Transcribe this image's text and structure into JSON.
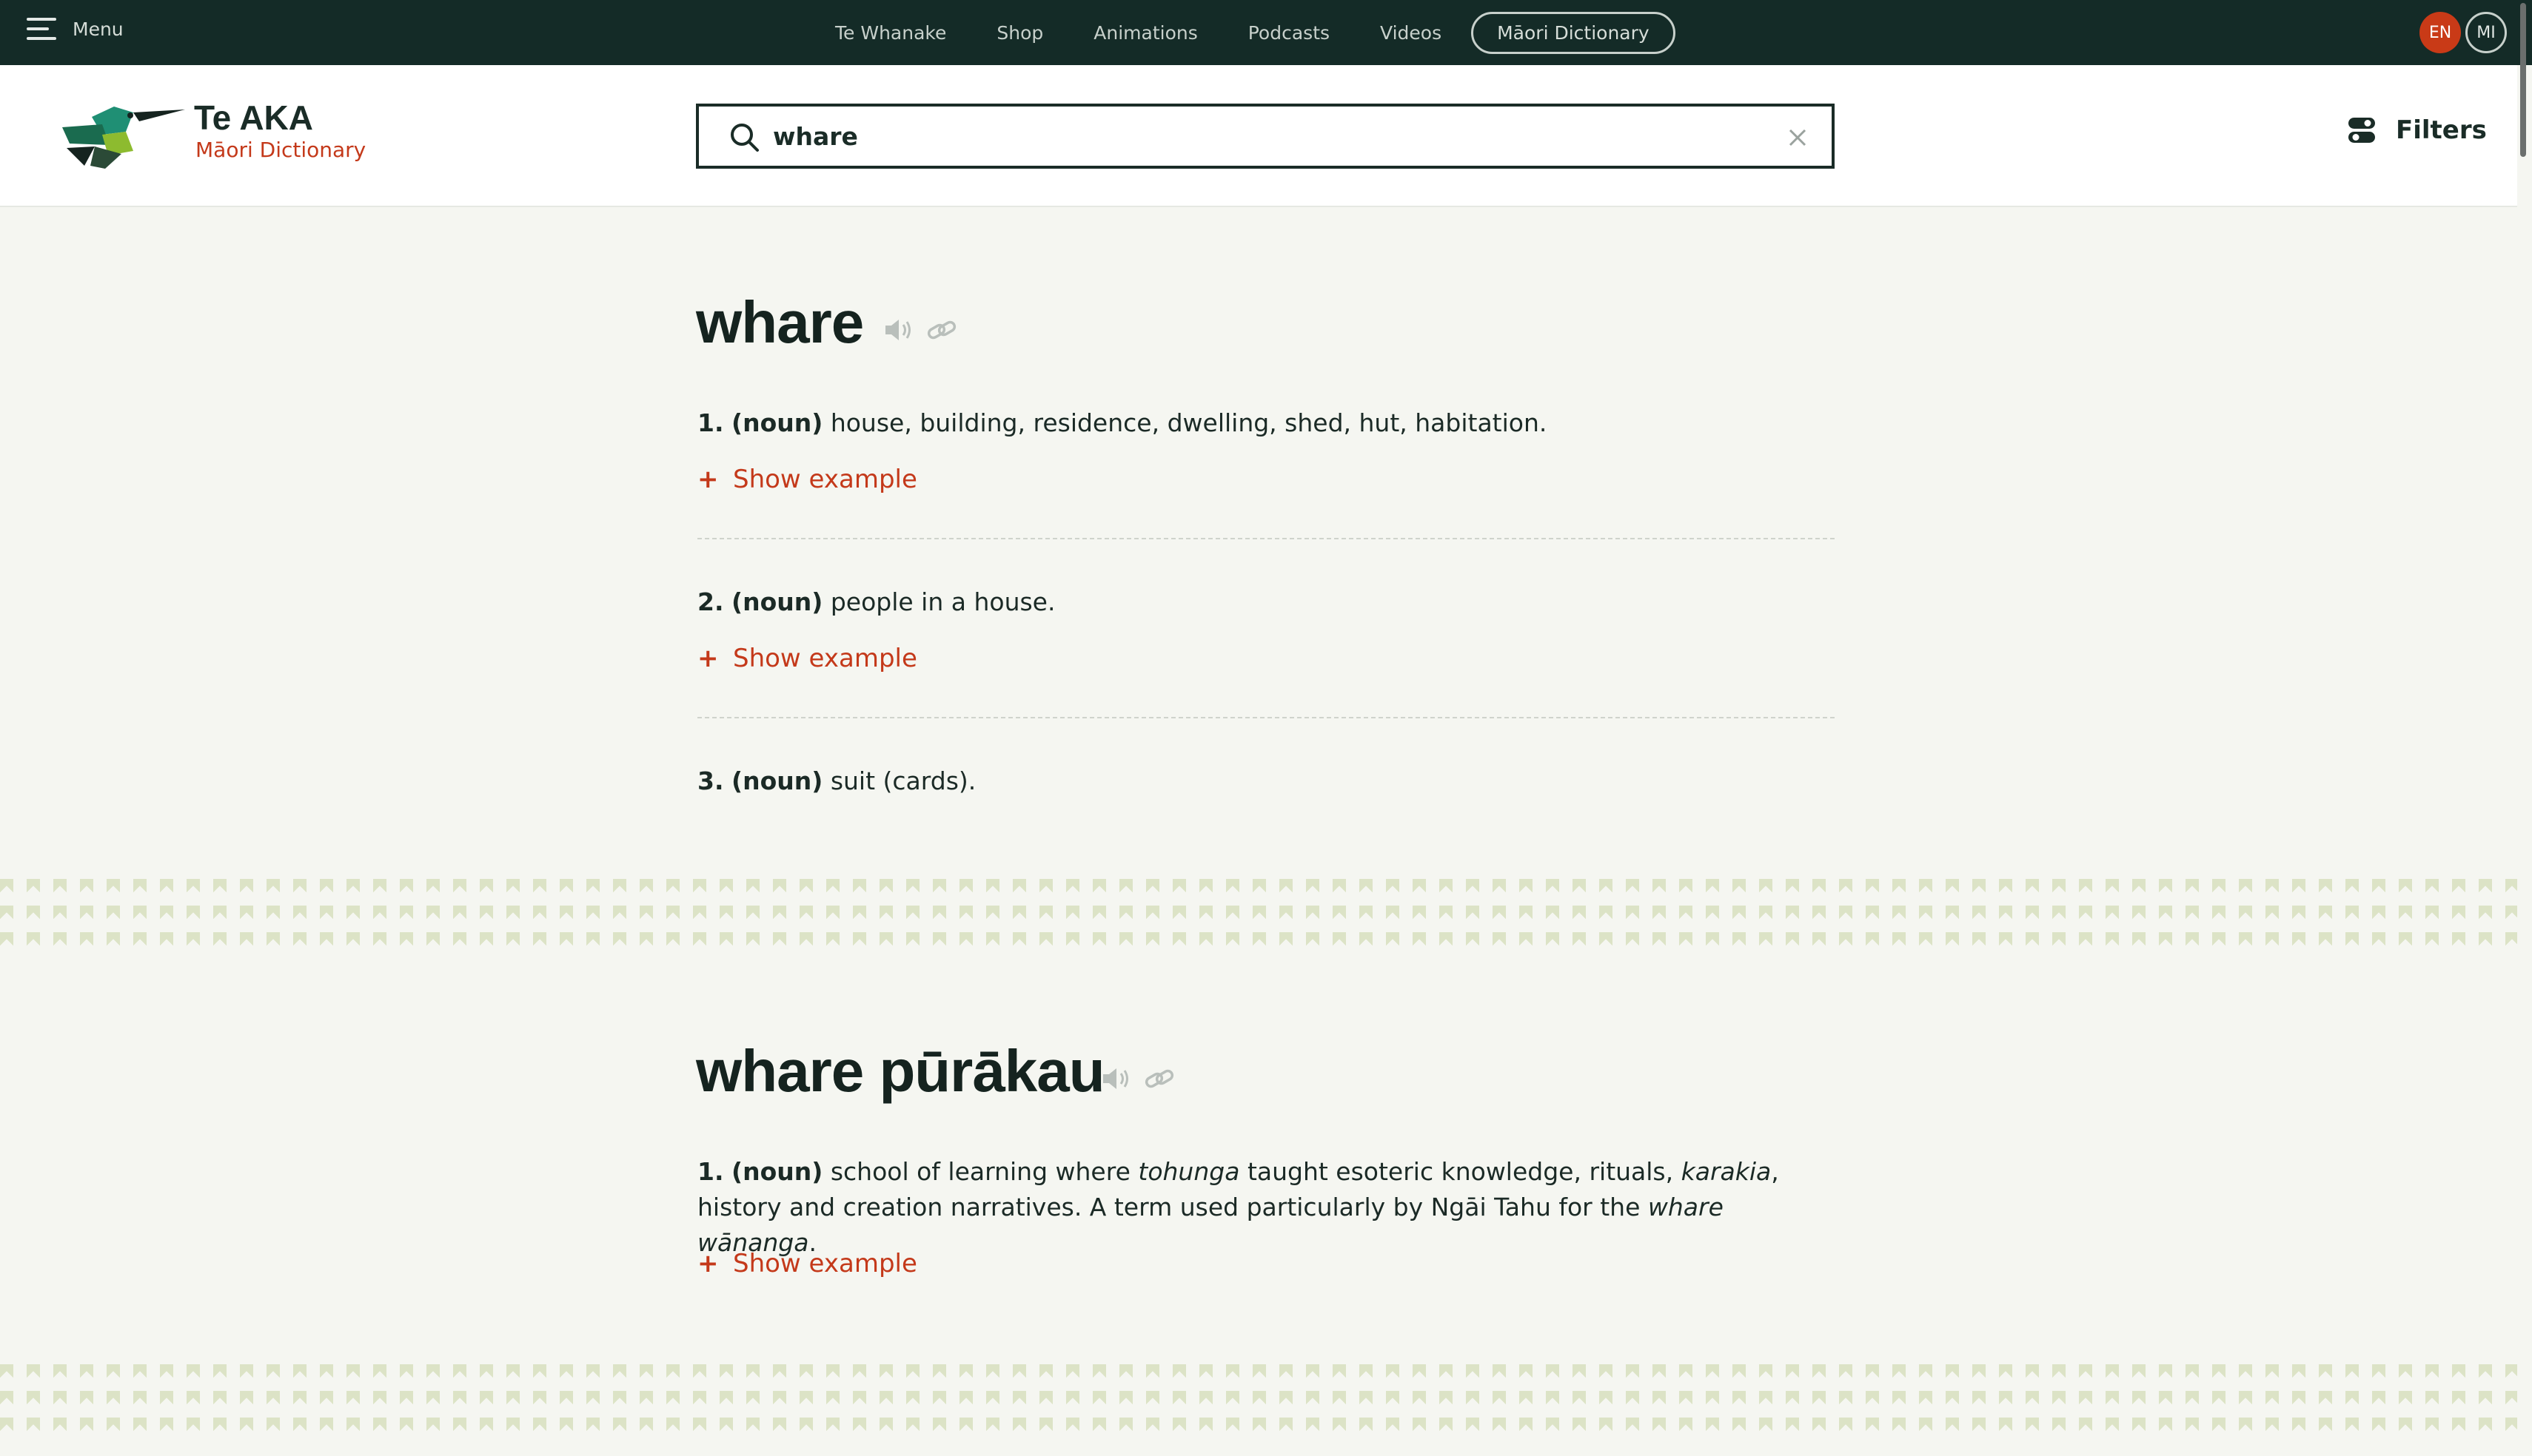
{
  "topnav": {
    "menu_label": "Menu",
    "links": [
      "Te Whanake",
      "Shop",
      "Animations",
      "Podcasts",
      "Videos"
    ],
    "active_link": "Māori Dictionary",
    "lang_en": "EN",
    "lang_mi": "MI"
  },
  "brand": {
    "title": "Te AKA",
    "subtitle": "Māori Dictionary"
  },
  "search": {
    "value": "whare"
  },
  "filters_label": "Filters",
  "entries": [
    {
      "headword": "whare",
      "senses": [
        {
          "num": "1.",
          "pos": "(noun)",
          "text": "house, building, residence, dwelling, shed, hut, habitation."
        },
        {
          "num": "2.",
          "pos": "(noun)",
          "text": "people in a house."
        },
        {
          "num": "3.",
          "pos": "(noun)",
          "text": "suit (cards)."
        }
      ]
    },
    {
      "headword": "whare pūrākau",
      "senses": [
        {
          "num": "1.",
          "pos": "(noun)",
          "text_a": "school of learning where",
          "em_a": "tohunga",
          "text_b": "taught esoteric knowledge, rituals,",
          "em_b": "karakia",
          "text_c": ", history and creation narratives. A term used particularly by Ngāi Tahu for the",
          "em_c": "whare wānanga",
          "text_d": "."
        }
      ]
    }
  ],
  "show_example_label": "Show example",
  "colors": {
    "nav_bg": "#142b27",
    "accent": "#c4391a",
    "page_bg": "#f5f6f1",
    "pattern": "#d8e0bf"
  },
  "icons": [
    "hamburger-icon",
    "search-icon",
    "close-icon",
    "filters-icon",
    "speaker-icon",
    "link-icon",
    "hummingbird-logo"
  ]
}
